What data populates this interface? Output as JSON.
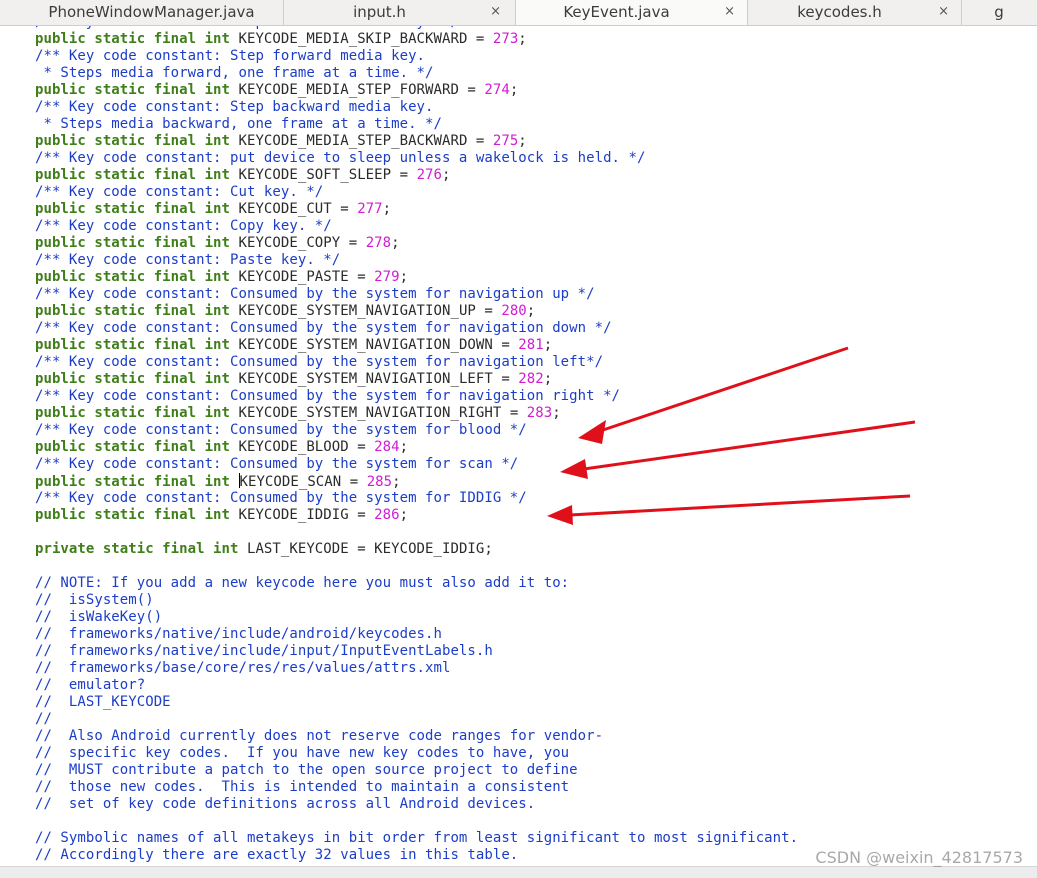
{
  "tabs": [
    {
      "label": "PhoneWindowManager.java",
      "close": "×",
      "active": false
    },
    {
      "label": "input.h",
      "close": "×",
      "active": false
    },
    {
      "label": "KeyEvent.java",
      "close": "×",
      "active": true
    },
    {
      "label": "keycodes.h",
      "close": "×",
      "active": false
    },
    {
      "label": "g",
      "close": "",
      "active": false
    }
  ],
  "code_lines": [
    [
      {
        "t": "cm",
        "v": "/** Key code constant: Skip backward media key. */"
      }
    ],
    [
      {
        "t": "kw",
        "v": "public static final int"
      },
      {
        "t": "p",
        "v": " KEYCODE_MEDIA_SKIP_BACKWARD = "
      },
      {
        "t": "num",
        "v": "273"
      },
      {
        "t": "p",
        "v": ";"
      }
    ],
    [
      {
        "t": "cm",
        "v": "/** Key code constant: Step forward media key."
      }
    ],
    [
      {
        "t": "cm",
        "v": " * Steps media forward, one frame at a time. */"
      }
    ],
    [
      {
        "t": "kw",
        "v": "public static final int"
      },
      {
        "t": "p",
        "v": " KEYCODE_MEDIA_STEP_FORWARD = "
      },
      {
        "t": "num",
        "v": "274"
      },
      {
        "t": "p",
        "v": ";"
      }
    ],
    [
      {
        "t": "cm",
        "v": "/** Key code constant: Step backward media key."
      }
    ],
    [
      {
        "t": "cm",
        "v": " * Steps media backward, one frame at a time. */"
      }
    ],
    [
      {
        "t": "kw",
        "v": "public static final int"
      },
      {
        "t": "p",
        "v": " KEYCODE_MEDIA_STEP_BACKWARD = "
      },
      {
        "t": "num",
        "v": "275"
      },
      {
        "t": "p",
        "v": ";"
      }
    ],
    [
      {
        "t": "cm",
        "v": "/** Key code constant: put device to sleep unless a wakelock is held. */"
      }
    ],
    [
      {
        "t": "kw",
        "v": "public static final int"
      },
      {
        "t": "p",
        "v": " KEYCODE_SOFT_SLEEP = "
      },
      {
        "t": "num",
        "v": "276"
      },
      {
        "t": "p",
        "v": ";"
      }
    ],
    [
      {
        "t": "cm",
        "v": "/** Key code constant: Cut key. */"
      }
    ],
    [
      {
        "t": "kw",
        "v": "public static final int"
      },
      {
        "t": "p",
        "v": " KEYCODE_CUT = "
      },
      {
        "t": "num",
        "v": "277"
      },
      {
        "t": "p",
        "v": ";"
      }
    ],
    [
      {
        "t": "cm",
        "v": "/** Key code constant: Copy key. */"
      }
    ],
    [
      {
        "t": "kw",
        "v": "public static final int"
      },
      {
        "t": "p",
        "v": " KEYCODE_COPY = "
      },
      {
        "t": "num",
        "v": "278"
      },
      {
        "t": "p",
        "v": ";"
      }
    ],
    [
      {
        "t": "cm",
        "v": "/** Key code constant: Paste key. */"
      }
    ],
    [
      {
        "t": "kw",
        "v": "public static final int"
      },
      {
        "t": "p",
        "v": " KEYCODE_PASTE = "
      },
      {
        "t": "num",
        "v": "279"
      },
      {
        "t": "p",
        "v": ";"
      }
    ],
    [
      {
        "t": "cm",
        "v": "/** Key code constant: Consumed by the system for navigation up */"
      }
    ],
    [
      {
        "t": "kw",
        "v": "public static final int"
      },
      {
        "t": "p",
        "v": " KEYCODE_SYSTEM_NAVIGATION_UP = "
      },
      {
        "t": "num",
        "v": "280"
      },
      {
        "t": "p",
        "v": ";"
      }
    ],
    [
      {
        "t": "cm",
        "v": "/** Key code constant: Consumed by the system for navigation down */"
      }
    ],
    [
      {
        "t": "kw",
        "v": "public static final int"
      },
      {
        "t": "p",
        "v": " KEYCODE_SYSTEM_NAVIGATION_DOWN = "
      },
      {
        "t": "num",
        "v": "281"
      },
      {
        "t": "p",
        "v": ";"
      }
    ],
    [
      {
        "t": "cm",
        "v": "/** Key code constant: Consumed by the system for navigation left*/"
      }
    ],
    [
      {
        "t": "kw",
        "v": "public static final int"
      },
      {
        "t": "p",
        "v": " KEYCODE_SYSTEM_NAVIGATION_LEFT = "
      },
      {
        "t": "num",
        "v": "282"
      },
      {
        "t": "p",
        "v": ";"
      }
    ],
    [
      {
        "t": "cm",
        "v": "/** Key code constant: Consumed by the system for navigation right */"
      }
    ],
    [
      {
        "t": "kw",
        "v": "public static final int"
      },
      {
        "t": "p",
        "v": " KEYCODE_SYSTEM_NAVIGATION_RIGHT = "
      },
      {
        "t": "num",
        "v": "283"
      },
      {
        "t": "p",
        "v": ";"
      }
    ],
    [
      {
        "t": "cm",
        "v": "/** Key code constant: Consumed by the system for blood */"
      }
    ],
    [
      {
        "t": "kw",
        "v": "public static final int"
      },
      {
        "t": "p",
        "v": " KEYCODE_BLOOD = "
      },
      {
        "t": "num",
        "v": "284"
      },
      {
        "t": "p",
        "v": ";"
      }
    ],
    [
      {
        "t": "cm",
        "v": "/** Key code constant: Consumed by the system for scan */"
      }
    ],
    [
      {
        "t": "kw",
        "v": "public static final int"
      },
      {
        "t": "p",
        "v": " "
      },
      {
        "t": "cursor",
        "v": ""
      },
      {
        "t": "p",
        "v": "KEYCODE_SCAN = "
      },
      {
        "t": "num",
        "v": "285"
      },
      {
        "t": "p",
        "v": ";"
      }
    ],
    [
      {
        "t": "cm",
        "v": "/** Key code constant: Consumed by the system for IDDIG */"
      }
    ],
    [
      {
        "t": "kw",
        "v": "public static final int"
      },
      {
        "t": "p",
        "v": " KEYCODE_IDDIG = "
      },
      {
        "t": "num",
        "v": "286"
      },
      {
        "t": "p",
        "v": ";"
      }
    ],
    [],
    [
      {
        "t": "kw",
        "v": "private static final int"
      },
      {
        "t": "p",
        "v": " LAST_KEYCODE = KEYCODE_IDDIG;"
      }
    ],
    [],
    [
      {
        "t": "cm",
        "v": "// NOTE: If you add a new keycode here you must also add it to:"
      }
    ],
    [
      {
        "t": "cm",
        "v": "//  isSystem()"
      }
    ],
    [
      {
        "t": "cm",
        "v": "//  isWakeKey()"
      }
    ],
    [
      {
        "t": "cm",
        "v": "//  frameworks/native/include/android/keycodes.h"
      }
    ],
    [
      {
        "t": "cm",
        "v": "//  frameworks/native/include/input/InputEventLabels.h"
      }
    ],
    [
      {
        "t": "cm",
        "v": "//  frameworks/base/core/res/res/values/attrs.xml"
      }
    ],
    [
      {
        "t": "cm",
        "v": "//  emulator?"
      }
    ],
    [
      {
        "t": "cm",
        "v": "//  LAST_KEYCODE"
      }
    ],
    [
      {
        "t": "cm",
        "v": "//"
      }
    ],
    [
      {
        "t": "cm",
        "v": "//  Also Android currently does not reserve code ranges for vendor-"
      }
    ],
    [
      {
        "t": "cm",
        "v": "//  specific key codes.  If you have new key codes to have, you"
      }
    ],
    [
      {
        "t": "cm",
        "v": "//  MUST contribute a patch to the open source project to define"
      }
    ],
    [
      {
        "t": "cm",
        "v": "//  those new codes.  This is intended to maintain a consistent"
      }
    ],
    [
      {
        "t": "cm",
        "v": "//  set of key code definitions across all Android devices."
      }
    ],
    [],
    [
      {
        "t": "cm",
        "v": "// Symbolic names of all metakeys in bit order from least significant to most significant."
      }
    ],
    [
      {
        "t": "cm",
        "v": "// Accordingly there are exactly 32 values in this table."
      }
    ]
  ],
  "annotation_color": "#e0101a",
  "watermark": "CSDN @weixin_42817573"
}
